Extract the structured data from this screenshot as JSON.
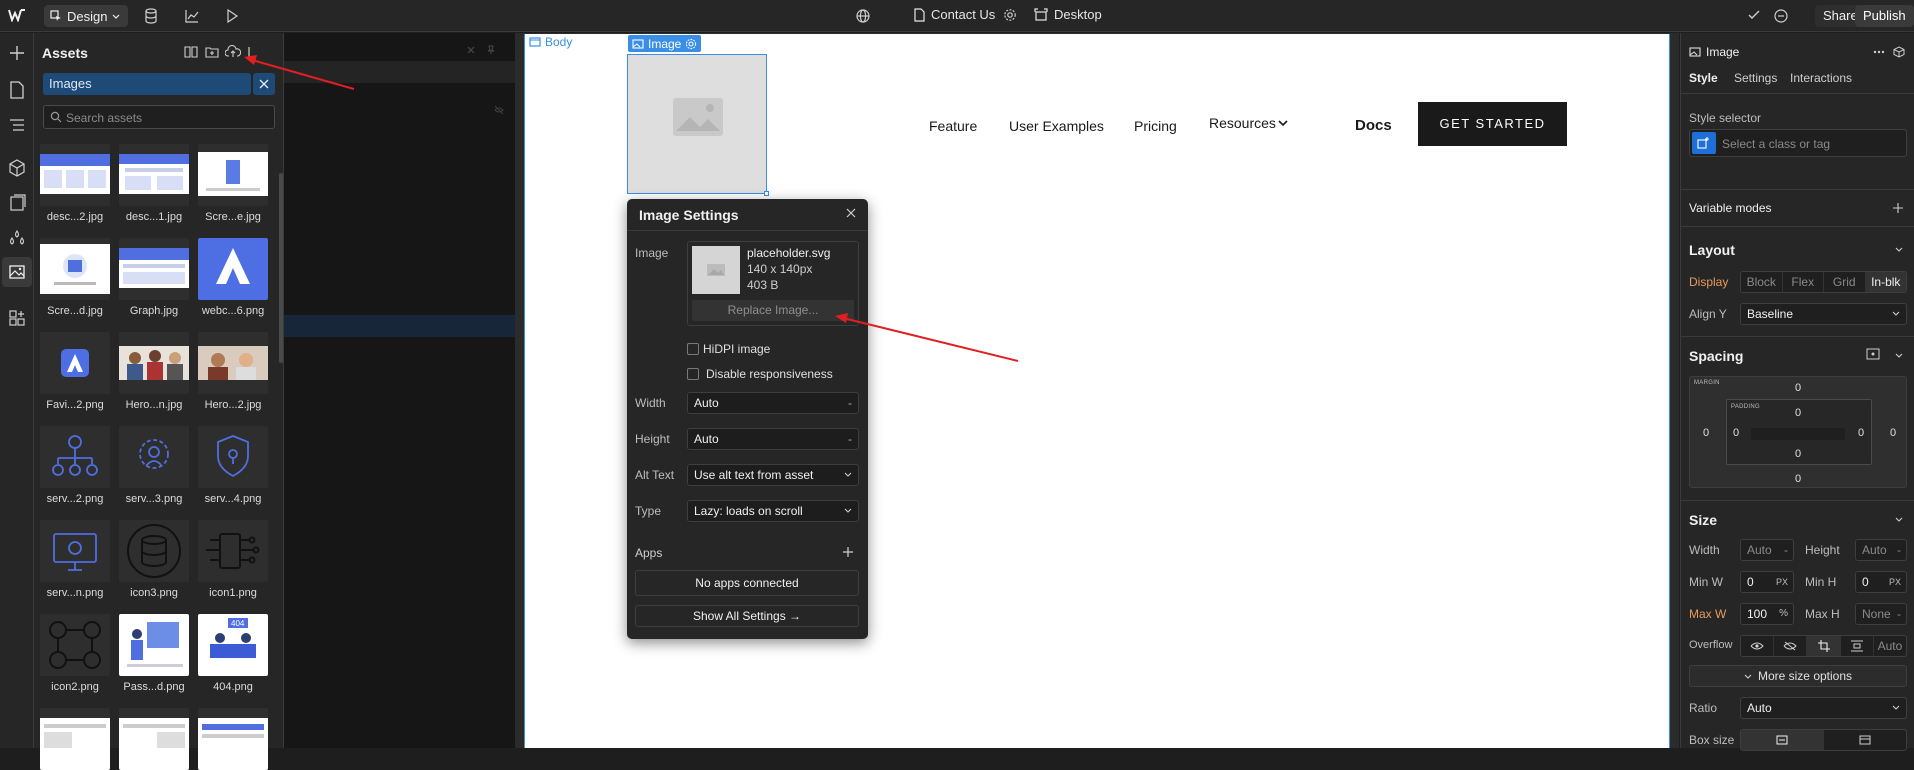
{
  "topbar": {
    "mode": "Design",
    "page": "Contact Us",
    "breakpoint": "Desktop",
    "share": "Share",
    "publish": "Publish"
  },
  "assets": {
    "title": "Assets",
    "filter": "Images",
    "search_placeholder": "Search assets",
    "items": [
      {
        "name": "desc...2.jpg"
      },
      {
        "name": "desc...1.jpg"
      },
      {
        "name": "Scre...e.jpg"
      },
      {
        "name": "Scre...d.jpg"
      },
      {
        "name": "Graph.jpg"
      },
      {
        "name": "webc...6.png"
      },
      {
        "name": "Favi...2.png"
      },
      {
        "name": "Hero...n.jpg"
      },
      {
        "name": "Hero...2.jpg"
      },
      {
        "name": "serv...2.png"
      },
      {
        "name": "serv...3.png"
      },
      {
        "name": "serv...4.png"
      },
      {
        "name": "serv...n.png"
      },
      {
        "name": "icon3.png"
      },
      {
        "name": "icon1.png"
      },
      {
        "name": "icon2.png"
      },
      {
        "name": "Pass...d.png"
      },
      {
        "name": "404.png"
      }
    ]
  },
  "canvas": {
    "body_label": "Body",
    "image_label": "Image",
    "nav": [
      "Feature",
      "User Examples",
      "Pricing",
      "Resources"
    ],
    "docs": "Docs",
    "cta": "GET STARTED",
    "badge_404": "404"
  },
  "image_settings": {
    "title": "Image Settings",
    "image_label": "Image",
    "file_name": "placeholder.svg",
    "file_dims": "140 x 140px",
    "file_size": "403 B",
    "replace": "Replace Image...",
    "hidpi": "HiDPI image",
    "disable_resp": "Disable responsiveness",
    "width_label": "Width",
    "width_value": "Auto",
    "height_label": "Height",
    "height_value": "Auto",
    "alt_label": "Alt Text",
    "alt_value": "Use alt text from asset",
    "type_label": "Type",
    "type_value": "Lazy: loads on scroll",
    "apps_label": "Apps",
    "no_apps": "No apps connected",
    "show_all": "Show All Settings →",
    "dash": "-"
  },
  "right_panel": {
    "element": "Image",
    "tabs": [
      "Style",
      "Settings",
      "Interactions"
    ],
    "style_selector_label": "Style selector",
    "style_selector_placeholder": "Select a class or tag",
    "variable_modes": "Variable modes",
    "layout": {
      "title": "Layout",
      "display_label": "Display",
      "display_options": [
        "Block",
        "Flex",
        "Grid",
        "In-blk"
      ],
      "align_y_label": "Align Y",
      "align_y_value": "Baseline"
    },
    "spacing": {
      "title": "Spacing",
      "margin_caption": "MARGIN",
      "padding_caption": "PADDING",
      "zero": "0"
    },
    "size": {
      "title": "Size",
      "width_label": "Width",
      "width_value": "Auto",
      "height_label": "Height",
      "height_value": "Auto",
      "dash": "-",
      "minw_label": "Min W",
      "minw_value": "0",
      "minh_label": "Min H",
      "minh_value": "0",
      "maxw_label": "Max W",
      "maxw_value": "100",
      "maxh_label": "Max H",
      "maxh_value": "None",
      "px": "PX",
      "pct": "%",
      "overflow_label": "Overflow",
      "overflow_auto": "Auto",
      "more": "More size options",
      "ratio_label": "Ratio",
      "ratio_value": "Auto",
      "boxsize_label": "Box size"
    }
  },
  "colors": {
    "accent": "#3a8ee6",
    "arrow": "#e02020",
    "warning_label": "#e89a5c"
  }
}
